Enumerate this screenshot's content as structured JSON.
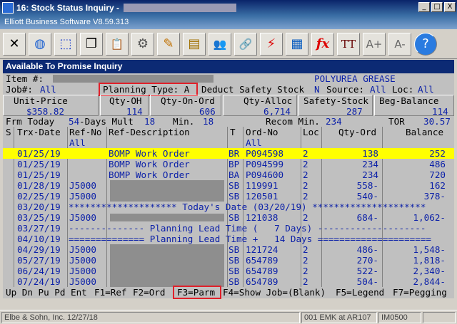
{
  "window": {
    "title": "16: Stock Status Inquiry - ",
    "subtitle": "Elliott Business Software V8.59.313",
    "btn_minimize": "_",
    "btn_maximize": "□",
    "btn_close": "X"
  },
  "toolbar": {
    "icons": [
      {
        "name": "exit-icon",
        "glyph": "✕"
      },
      {
        "name": "globe-icon",
        "glyph": "◍"
      },
      {
        "name": "select-icon",
        "glyph": "⬚"
      },
      {
        "name": "copy-icon",
        "glyph": "❐"
      },
      {
        "name": "paste-icon",
        "glyph": "📋"
      },
      {
        "name": "settings-icon",
        "glyph": "⚙"
      },
      {
        "name": "edit-icon",
        "glyph": "✎"
      },
      {
        "name": "notes-icon",
        "glyph": "▤"
      },
      {
        "name": "users-icon",
        "glyph": "👥"
      },
      {
        "name": "link-icon",
        "glyph": "🔗"
      },
      {
        "name": "flash-icon",
        "glyph": "⚡"
      },
      {
        "name": "calc-icon",
        "glyph": "▦"
      },
      {
        "name": "function-icon",
        "glyph": "fx"
      },
      {
        "name": "font-icon",
        "glyph": "TT"
      },
      {
        "name": "font-increase-icon",
        "glyph": "A+"
      },
      {
        "name": "font-decrease-icon",
        "glyph": "A-"
      },
      {
        "name": "help-icon",
        "glyph": "?"
      }
    ]
  },
  "panel_title": "Available To Promise Inquiry",
  "header": {
    "item_label": "Item #:",
    "item_desc": "POLYUREA GREASE",
    "job_label": "Job#:",
    "job_value": "All",
    "planning_type": "Planning Type: A",
    "deduct_label": "Deduct Safety Stock",
    "deduct_value": "N",
    "source_label": "Source:",
    "source_value": "All",
    "loc_label": "Loc:",
    "loc_value": "All",
    "unit_price_label": "Unit-Price",
    "unit_price": "$358.82",
    "qty_oh_label": "Qty-OH",
    "qty_oh": "114",
    "qty_on_ord_label": "Qty-On-Ord",
    "qty_on_ord": "606",
    "qty_alloc_label": "Qty-Alloc",
    "qty_alloc": "6,714",
    "safety_label": "Safety-Stock",
    "safety": "287",
    "beg_bal_label": "Beg-Balance",
    "beg_bal": "114",
    "frm_today": "Frm Today",
    "days_val": "54",
    "days_mult": "-Days Mult",
    "mult_val": "18",
    "min_label": "Min.",
    "min_val": "18",
    "recom_label": "Recom Min.",
    "recom_val": "234",
    "tor_label": "TOR",
    "tor_val": "30.57"
  },
  "columns": {
    "s": "S",
    "date": "Trx-Date",
    "refno": "Ref-No",
    "refno2": "All",
    "desc": "Ref-Description",
    "t": "T",
    "ordno": "Ord-No",
    "ordno2": "All",
    "loc": "Loc",
    "qty": "Qty-Ord",
    "bal": "Balance"
  },
  "rows": [
    {
      "date": "01/25/19",
      "ref": "",
      "desc": "BOMP Work Order",
      "t": "BR",
      "ord": "P094598",
      "loc": "2",
      "qty": "138",
      "bal": "252"
    },
    {
      "date": "01/25/19",
      "ref": "",
      "desc": "BOMP Work Order",
      "t": "BP",
      "ord": "P094599",
      "loc": "2",
      "qty": "234",
      "bal": "486"
    },
    {
      "date": "01/25/19",
      "ref": "",
      "desc": "BOMP Work Order",
      "t": "BA",
      "ord": "P094600",
      "loc": "2",
      "qty": "234",
      "bal": "720"
    },
    {
      "date": "01/28/19",
      "ref": "J5000",
      "desc": "",
      "t": "SB",
      "ord": "119991",
      "loc": "2",
      "qty": "558-",
      "bal": "162"
    },
    {
      "date": "02/25/19",
      "ref": "J5000",
      "desc": "",
      "t": "SB",
      "ord": "120501",
      "loc": "2",
      "qty": "540-",
      "bal": "378-"
    },
    {
      "date": "03/25/19",
      "ref": "J5000",
      "desc": "",
      "t": "SB",
      "ord": "121038",
      "loc": "2",
      "qty": "684-",
      "bal": "1,062-"
    },
    {
      "date": "04/29/19",
      "ref": "J5000",
      "desc": "",
      "t": "SB",
      "ord": "121724",
      "loc": "2",
      "qty": "486-",
      "bal": "1,548-"
    },
    {
      "date": "05/27/19",
      "ref": "J5000",
      "desc": "",
      "t": "SB",
      "ord": "654789",
      "loc": "2",
      "qty": "270-",
      "bal": "1,818-"
    },
    {
      "date": "06/24/19",
      "ref": "J5000",
      "desc": "",
      "t": "SB",
      "ord": "654789",
      "loc": "2",
      "qty": "522-",
      "bal": "2,340-"
    },
    {
      "date": "07/24/19",
      "ref": "J5000",
      "desc": "",
      "t": "SB",
      "ord": "654789",
      "loc": "2",
      "qty": "504-",
      "bal": "2,844-"
    }
  ],
  "markers": {
    "today_date": "03/20/19",
    "today_line": "******************** Today's Date (03/20/19) *********************",
    "plead1_date": "03/27/19",
    "plead1_line": "-------------- Planning Lead Time (   7 Days) --------------------",
    "plead2_date": "04/10/19",
    "plead2_line": "============== Planning Lead Time +   14 Days ====================="
  },
  "fkeys": {
    "nav": "Up Dn Pu Pd Ent",
    "f1": "F1=Ref",
    "f2": "F2=Ord",
    "f3": "F3=Parm",
    "f4": "F4=Show Job=(Blank)",
    "f5": "F5=Legend",
    "f7": "F7=Pegging"
  },
  "status": {
    "company": "Elbe & Sohn, Inc. 12/27/18",
    "user": "001 EMK at AR107",
    "program": "IM0500"
  },
  "colors": {
    "highlight_row": "#ffff00",
    "annotation_box": "#e0202a",
    "text_blue": "#0a1fa8"
  }
}
